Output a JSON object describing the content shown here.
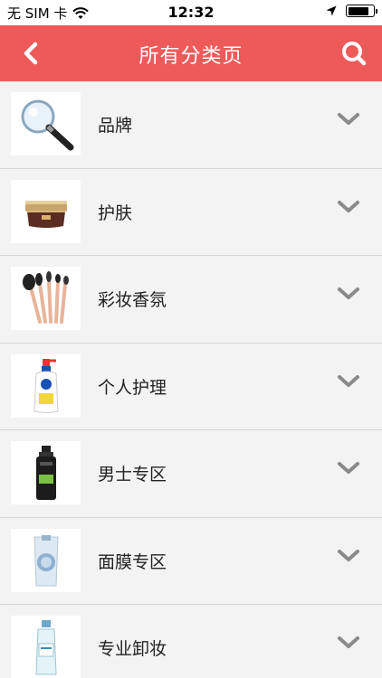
{
  "status": {
    "carrier": "无 SIM 卡",
    "time": "12:32",
    "battery_level": 0.85
  },
  "nav": {
    "title": "所有分类页",
    "back_icon": "chevron-left-icon",
    "search_icon": "search-icon"
  },
  "theme": {
    "accent": "#ee5a5a"
  },
  "categories": [
    {
      "label": "品牌",
      "icon": "magnifier-image"
    },
    {
      "label": "护肤",
      "icon": "cream-jar-image"
    },
    {
      "label": "彩妆香氛",
      "icon": "makeup-brushes-image"
    },
    {
      "label": "个人护理",
      "icon": "body-wash-bottle-image"
    },
    {
      "label": "男士专区",
      "icon": "men-cleanser-image"
    },
    {
      "label": "面膜专区",
      "icon": "face-mask-pouch-image"
    },
    {
      "label": "专业卸妆",
      "icon": "micellar-water-image"
    }
  ]
}
